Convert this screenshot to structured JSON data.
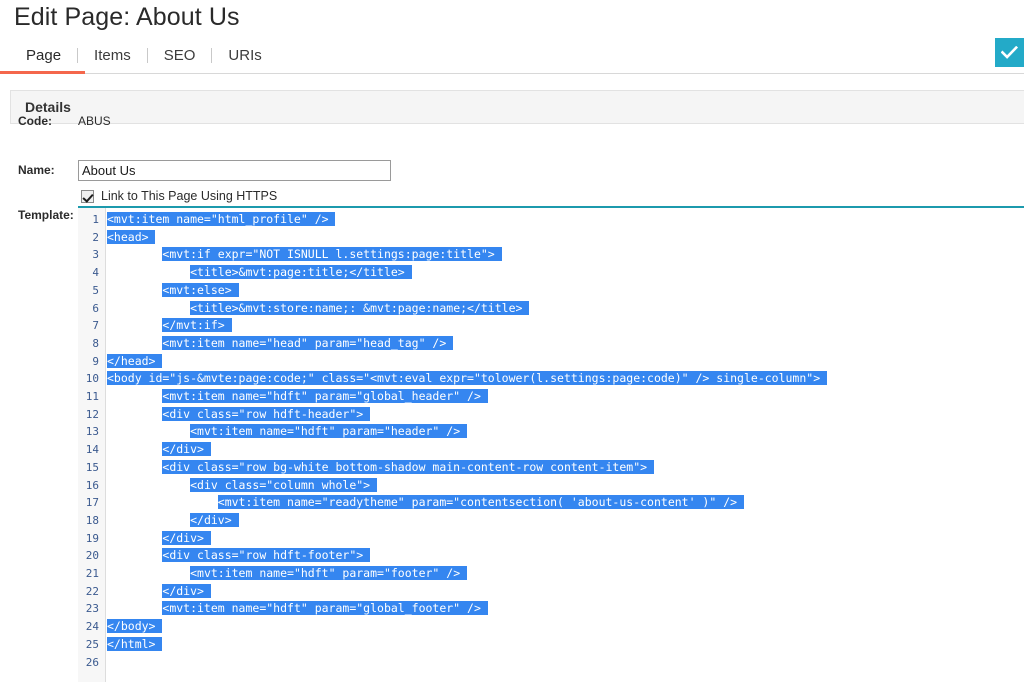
{
  "page": {
    "title": "Edit Page: About Us"
  },
  "tabs": [
    {
      "label": "Page",
      "active": true
    },
    {
      "label": "Items",
      "active": false
    },
    {
      "label": "SEO",
      "active": false
    },
    {
      "label": "URIs",
      "active": false
    }
  ],
  "toolbar": {
    "save_icon": "check-icon",
    "save_color": "#23aac8",
    "active_tab_color": "#f4674c"
  },
  "panel": {
    "header": "Details"
  },
  "form": {
    "code_label": "Code:",
    "code_value": "ABUS",
    "name_label": "Name:",
    "name_value": "About Us",
    "name_placeholder": "",
    "https_checkbox_label": "Link to This Page Using HTTPS",
    "https_checked": true,
    "template_label": "Template:"
  },
  "editor": {
    "selection_color": "#3586f0",
    "focus_border_color": "#1c9aad",
    "lines": [
      {
        "n": 1,
        "text": "<mvt:item name=\"html_profile\" />",
        "indent": 0,
        "selected": true
      },
      {
        "n": 2,
        "text": "<head>",
        "indent": 0,
        "selected": true
      },
      {
        "n": 3,
        "text": "<mvt:if expr=\"NOT ISNULL l.settings:page:title\">",
        "indent": 8,
        "selected": true
      },
      {
        "n": 4,
        "text": "<title>&mvt:page:title;</title>",
        "indent": 12,
        "selected": true
      },
      {
        "n": 5,
        "text": "<mvt:else>",
        "indent": 8,
        "selected": true
      },
      {
        "n": 6,
        "text": "<title>&mvt:store:name;: &mvt:page:name;</title>",
        "indent": 12,
        "selected": true
      },
      {
        "n": 7,
        "text": "</mvt:if>",
        "indent": 8,
        "selected": true
      },
      {
        "n": 8,
        "text": "<mvt:item name=\"head\" param=\"head_tag\" />",
        "indent": 8,
        "selected": true
      },
      {
        "n": 9,
        "text": "</head>",
        "indent": 0,
        "selected": true
      },
      {
        "n": 10,
        "text": "<body id=\"js-&mvte:page:code;\" class=\"<mvt:eval expr=\"tolower(l.settings:page:code)\" /> single-column\">",
        "indent": 0,
        "selected": true
      },
      {
        "n": 11,
        "text": "<mvt:item name=\"hdft\" param=\"global_header\" />",
        "indent": 8,
        "selected": true
      },
      {
        "n": 12,
        "text": "<div class=\"row hdft-header\">",
        "indent": 8,
        "selected": true
      },
      {
        "n": 13,
        "text": "<mvt:item name=\"hdft\" param=\"header\" />",
        "indent": 12,
        "selected": true
      },
      {
        "n": 14,
        "text": "</div>",
        "indent": 8,
        "selected": true
      },
      {
        "n": 15,
        "text": "<div class=\"row bg-white bottom-shadow main-content-row content-item\">",
        "indent": 8,
        "selected": true
      },
      {
        "n": 16,
        "text": "<div class=\"column whole\">",
        "indent": 12,
        "selected": true
      },
      {
        "n": 17,
        "text": "<mvt:item name=\"readytheme\" param=\"contentsection( 'about-us-content' )\" />",
        "indent": 16,
        "selected": true
      },
      {
        "n": 18,
        "text": "</div>",
        "indent": 12,
        "selected": true
      },
      {
        "n": 19,
        "text": "</div>",
        "indent": 8,
        "selected": true
      },
      {
        "n": 20,
        "text": "<div class=\"row hdft-footer\">",
        "indent": 8,
        "selected": true
      },
      {
        "n": 21,
        "text": "<mvt:item name=\"hdft\" param=\"footer\" />",
        "indent": 12,
        "selected": true
      },
      {
        "n": 22,
        "text": "</div>",
        "indent": 8,
        "selected": true
      },
      {
        "n": 23,
        "text": "<mvt:item name=\"hdft\" param=\"global_footer\" />",
        "indent": 8,
        "selected": true
      },
      {
        "n": 24,
        "text": "</body>",
        "indent": 0,
        "selected": true
      },
      {
        "n": 25,
        "text": "</html>",
        "indent": 0,
        "selected": true
      },
      {
        "n": 26,
        "text": "",
        "indent": 0,
        "selected": false
      }
    ]
  }
}
